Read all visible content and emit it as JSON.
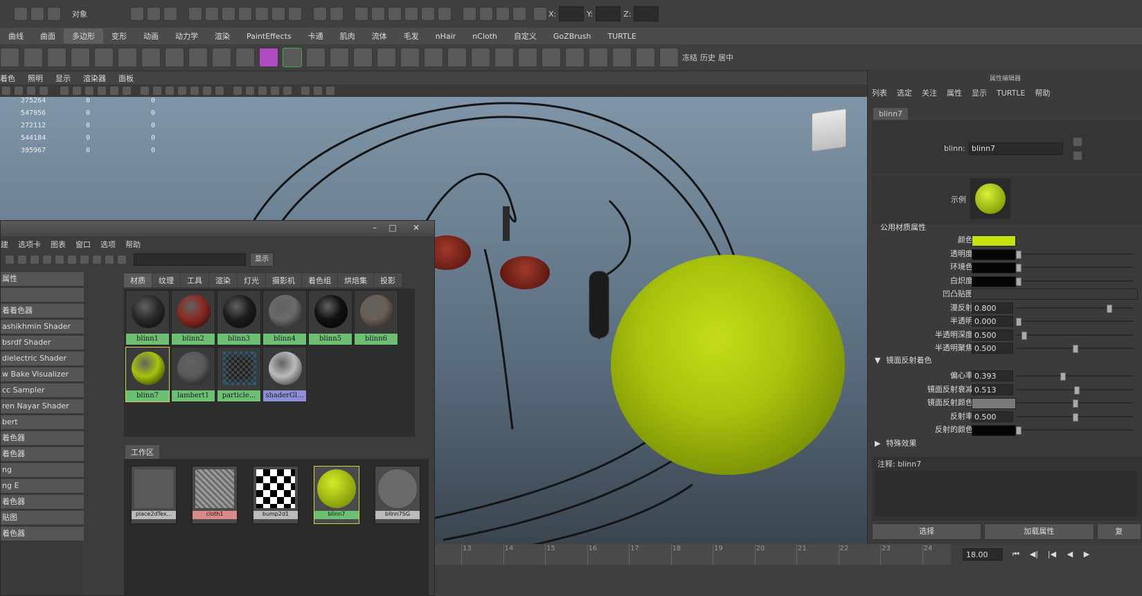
{
  "status_bar": {
    "mode_label": "对象",
    "coord_x": "X:",
    "coord_y": "Y:",
    "coord_z": "Z:"
  },
  "shelf_tabs": [
    "曲线",
    "曲面",
    "多边形",
    "变形",
    "动画",
    "动力学",
    "渲染",
    "PaintEffects",
    "卡通",
    "肌肉",
    "流体",
    "毛发",
    "nHair",
    "nCloth",
    "自定义",
    "GoZBrush",
    "TURTLE"
  ],
  "shelf_active_index": 2,
  "shelf_icon_labels": {
    "freeze": "冻结",
    "history": "历史",
    "center": "居中"
  },
  "viewport_menu": [
    "着色",
    "照明",
    "显示",
    "渲染器",
    "面板"
  ],
  "hud_stats": [
    {
      "a": "275264",
      "b": "0",
      "c": "0"
    },
    {
      "a": "547956",
      "b": "0",
      "c": "0"
    },
    {
      "a": "272112",
      "b": "0",
      "c": "0"
    },
    {
      "a": "544184",
      "b": "0",
      "c": "0"
    },
    {
      "a": "395967",
      "b": "0",
      "c": "0"
    }
  ],
  "hypershade": {
    "menu": [
      "建",
      "选项卡",
      "图表",
      "窗口",
      "选项",
      "帮助"
    ],
    "show_button": "显示",
    "left_panel": [
      "属性",
      "",
      "着着色器",
      "ashikhmin Shader",
      "bsrdf Shader",
      "dielectric Shader",
      "w Bake Visualizer",
      "cc Sampler",
      "ren Nayar Shader",
      "bert",
      "着色器",
      "着色器",
      "ng",
      "ng E",
      "着色器",
      "贴图",
      "着色器"
    ],
    "tabs": [
      "材质",
      "纹理",
      "工具",
      "渲染",
      "灯光",
      "摄影机",
      "着色组",
      "烘焙集",
      "投影"
    ],
    "active_tab": 0,
    "swatches": [
      {
        "label": "blinn1",
        "color": "#2a2a2a"
      },
      {
        "label": "blinn2",
        "color": "#8b2a22"
      },
      {
        "label": "blinn3",
        "color": "#1d1d1d"
      },
      {
        "label": "blinn4",
        "color": "#6a6a6a"
      },
      {
        "label": "blinn5",
        "color": "#111111"
      },
      {
        "label": "blinn6",
        "color": "#6a5e56"
      },
      {
        "label": "blinn7",
        "color": "#a8c20e"
      },
      {
        "label": "lambert1",
        "color": "#5a5a5a"
      },
      {
        "label": "particle...",
        "color": "#2f6f8a"
      },
      {
        "label": "shaderGl...",
        "color": "#bbbbbb"
      }
    ],
    "work_area_tab": "工作区",
    "nodes": [
      {
        "label": "place2dTex..."
      },
      {
        "label": "cloth1"
      },
      {
        "label": "bump2d1"
      },
      {
        "label": "blinn7"
      },
      {
        "label": "blinn7SG"
      }
    ]
  },
  "attribute_editor": {
    "title": "属性编辑器",
    "menu": [
      "列表",
      "选定",
      "关注",
      "属性",
      "显示",
      "TURTLE",
      "帮助"
    ],
    "tab": "blinn7",
    "blinn_label": "blinn:",
    "blinn_value": "blinn7",
    "sample_label": "示例",
    "common_section": "公用材质属性",
    "rows": [
      {
        "label": "颜色",
        "type": "swatch",
        "color": "#c6e012"
      },
      {
        "label": "透明度",
        "type": "swatch",
        "color": "#050505",
        "slider": 0.0
      },
      {
        "label": "环境色",
        "type": "swatch",
        "color": "#050505",
        "slider": 0.0
      },
      {
        "label": "白炽度",
        "type": "swatch",
        "color": "#050505",
        "slider": 0.0
      },
      {
        "label": "凹凸贴图",
        "type": "map"
      },
      {
        "label": "漫反射",
        "type": "value",
        "value": "0.800",
        "slider": 0.8
      },
      {
        "label": "半透明",
        "type": "value",
        "value": "0.000",
        "slider": 0.0
      },
      {
        "label": "半透明深度",
        "type": "value",
        "value": "0.500",
        "slider": 0.05
      },
      {
        "label": "半透明聚焦",
        "type": "value",
        "value": "0.500",
        "slider": 0.5
      }
    ],
    "specular_section": "镜面反射着色",
    "spec_rows": [
      {
        "label": "偏心率",
        "type": "value",
        "value": "0.393",
        "slider": 0.393
      },
      {
        "label": "镜面反射衰减",
        "type": "value",
        "value": "0.513",
        "slider": 0.513
      },
      {
        "label": "镜面反射颜色",
        "type": "swatch",
        "color": "#7a7a7a",
        "slider": 0.5
      },
      {
        "label": "反射率",
        "type": "value",
        "value": "0.500",
        "slider": 0.5
      },
      {
        "label": "反射的颜色",
        "type": "swatch",
        "color": "#050505",
        "slider": 0.0
      }
    ],
    "special_section": "特殊效果",
    "notes_label": "注释: blinn7",
    "buttons": [
      "选择",
      "加载属性",
      "复"
    ]
  },
  "timeline": {
    "ticks": [
      "13",
      "14",
      "15",
      "16",
      "17",
      "18",
      "19",
      "20",
      "21",
      "22",
      "23",
      "24"
    ],
    "current_time": "18.00"
  }
}
